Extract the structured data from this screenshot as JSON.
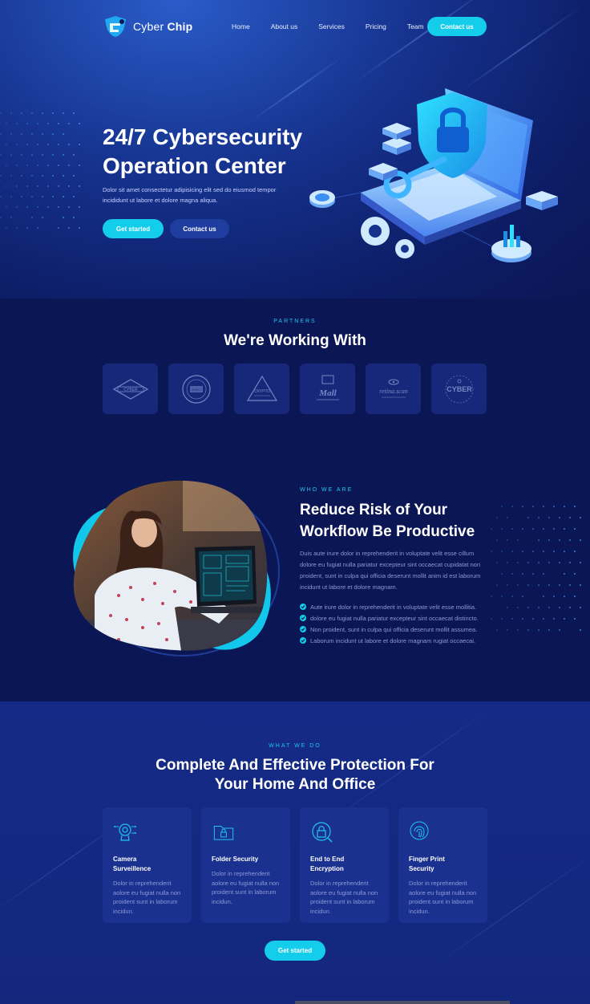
{
  "brand": {
    "name_light": "Cyber",
    "name_bold": "Chip"
  },
  "nav": {
    "links": [
      "Home",
      "About us",
      "Services",
      "Pricing",
      "Team"
    ],
    "cta": "Contact us"
  },
  "hero": {
    "title": "24/7 Cybersecurity Operation Center",
    "description": "Dolor sit amet consectetur adipisicing elit sed do eiusmod tempor incididunt ut labore et dolore magna aliqua.",
    "primary_button": "Get started",
    "secondary_button": "Contact us"
  },
  "partners": {
    "eyebrow": "PARTNERS",
    "title": "We're Working With",
    "logos": [
      "CYBER",
      "SHIELD",
      "CRYPTO",
      "Mall",
      "retina.scan",
      "CYBER"
    ]
  },
  "about": {
    "eyebrow": "WHO WE ARE",
    "title": "Reduce Risk of Your Workflow Be Productive",
    "description": "Duis aute irure dolor in reprehenderit in voluptate velit esse cillum dolore eu fugiat nulla pariatur excepteur sint occaecat cupidatat non proident, sunt in culpa qui officia deserunt mollit anim id est laborum incidunt ut labore et dolore magnam.",
    "checklist": [
      "Aute irure dolor in reprehenderit in voluptate velit esse mollitia.",
      "dolore eu fugiat nulla pariatur excepteur sint occaecat distincto.",
      "Non proident, sunt in culpa qui officia deserunt mollit assumea.",
      "Laborum incidunt ut labore et dolore magnam rugiat occaecai."
    ]
  },
  "services": {
    "eyebrow": "WHAT WE DO",
    "title_line1": "Complete And Effective Protection For",
    "title_line2": "Your Home And Office",
    "cards": [
      {
        "icon": "camera-icon",
        "title": "Camera Surveillence",
        "desc": "Dolor in reprehenderit aolore eu fugiat nulla non proident sunt in laborum incidun."
      },
      {
        "icon": "folder-lock-icon",
        "title": "Folder Security",
        "desc": "Dolor in reprehenderit aolore eu fugiat nulla non proident sunt in laborum incidun."
      },
      {
        "icon": "lock-icon",
        "title": "End to End Encryption",
        "desc": "Dolor in reprehenderit aolore eu fugiat nulla non proident sunt in laborum incidun."
      },
      {
        "icon": "fingerprint-icon",
        "title": "Finger Print Security",
        "desc": "Dolor in reprehenderit aolore eu fugiat nulla non proident sunt in laborum incidun."
      }
    ],
    "button": "Get started"
  },
  "colors": {
    "accent": "#14cdea",
    "background": "#0b1654",
    "card": "#1a3190",
    "muted_text": "#8d9ad6"
  }
}
